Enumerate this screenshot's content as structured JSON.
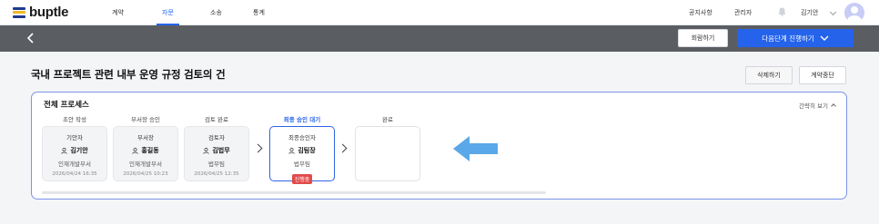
{
  "header": {
    "logo": "buptle",
    "nav": [
      "계약",
      "자문",
      "소송",
      "통계"
    ],
    "active_nav": "자문",
    "utils": [
      "공지사항",
      "관리자"
    ],
    "user_name": "김기안"
  },
  "actionbar": {
    "back_icon": "chevron-left-icon",
    "recall_label": "회람하기",
    "next_label": "다음단계 진행하기"
  },
  "page": {
    "title": "국내 프로젝트 관련 내부 운영 규정 검토의 건",
    "delete_label": "삭제하기",
    "stop_label": "계약중단"
  },
  "process": {
    "title": "전체 프로세스",
    "brief_label": "간략히 보기",
    "steps": [
      {
        "label": "초안 작성",
        "role": "기안자",
        "name": "김기안",
        "dept": "인재개발부서",
        "date": "2026/04/24 16:35"
      },
      {
        "label": "부서장 승인",
        "role": "부서장",
        "name": "홍길동",
        "dept": "인재개발부서",
        "date": "2026/04/25 10:23"
      },
      {
        "label": "검토 완료",
        "role": "검토자",
        "name": "김법무",
        "dept": "법무팀",
        "date": "2026/04/25 12:35"
      },
      {
        "label": "최종 승인 대기",
        "role": "최종승인자",
        "name": "김팀장",
        "dept": "법무팀",
        "status": "진행중"
      },
      {
        "label": "완료"
      }
    ]
  },
  "colors": {
    "accent": "#2563eb",
    "arrow": "#5aa8e8",
    "badge": "#e24b4b"
  }
}
